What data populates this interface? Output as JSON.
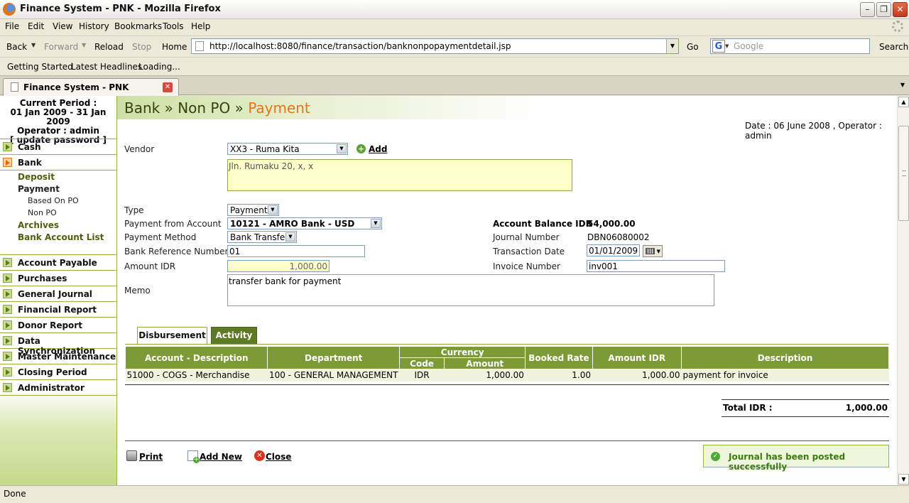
{
  "window": {
    "title": "Finance System - PNK - Mozilla Firefox"
  },
  "menu": [
    "File",
    "Edit",
    "View",
    "History",
    "Bookmarks",
    "Tools",
    "Help"
  ],
  "nav": {
    "back": "Back",
    "forward": "Forward",
    "reload": "Reload",
    "stop": "Stop",
    "home": "Home",
    "url": "http://localhost:8080/finance/transaction/banknonpopaymentdetail.jsp",
    "go": "Go",
    "search_placeholder": "Google",
    "search_button": "Search"
  },
  "bookmarks": [
    "Getting Started",
    "Latest Headlines",
    "Loading..."
  ],
  "tab": {
    "label": "Finance System - PNK"
  },
  "status": "Done",
  "sidebar": {
    "period_title": "Current Period :",
    "period_range": "01 Jan 2009 - 31 Jan 2009",
    "operator": "Operator : admin",
    "update_password": "[ update password ]",
    "items": [
      {
        "label": "Cash"
      },
      {
        "label": "Bank"
      },
      {
        "label": "Account Payable"
      },
      {
        "label": "Purchases"
      },
      {
        "label": "General Journal"
      },
      {
        "label": "Financial Report"
      },
      {
        "label": "Donor Report"
      },
      {
        "label": "Data Synchronization"
      },
      {
        "label": "Master Maintenance"
      },
      {
        "label": "Closing Period"
      },
      {
        "label": "Administrator"
      }
    ],
    "bank_sub": {
      "deposit": "Deposit",
      "payment": "Payment",
      "based_on_po": "Based On PO",
      "non_po": "Non PO",
      "archives": "Archives",
      "account_list": "Bank Account List"
    }
  },
  "page": {
    "breadcrumb_1": "Bank",
    "breadcrumb_2": "Non PO",
    "breadcrumb_current": "Payment",
    "sep": "»",
    "date_line": "Date : 06 June 2008 ,  Operator : admin"
  },
  "form": {
    "vendor_label": "Vendor",
    "vendor_value": "XX3 - Ruma Kita",
    "add_label": "Add",
    "address_value": "Jln. Rumaku 20, x, x",
    "type_label": "Type",
    "type_value": "Payment",
    "from_account_label": "Payment from Account",
    "from_account_value": "10121 - AMRO Bank - USD",
    "method_label": "Payment Method",
    "method_value": "Bank Transfer",
    "bank_ref_label": "Bank Reference Number",
    "bank_ref_value": "01",
    "amount_label": "Amount IDR",
    "amount_value": "1,000.00",
    "memo_label": "Memo",
    "memo_value": "transfer bank for payment",
    "balance_label": "Account Balance IDR",
    "balance_value": "54,000.00",
    "journal_label": "Journal Number",
    "journal_value": "DBN06080002",
    "trans_date_label": "Transaction Date",
    "trans_date_value": "01/01/2009",
    "invoice_label": "Invoice Number",
    "invoice_value": "inv001"
  },
  "detail_tabs": {
    "disbursement": "Disbursement",
    "activity": "Activity"
  },
  "grid": {
    "headers": {
      "account": "Account - Description",
      "department": "Department",
      "currency": "Currency",
      "code": "Code",
      "amount": "Amount",
      "booked_rate": "Booked Rate",
      "amount_idr": "Amount IDR",
      "description": "Description"
    },
    "rows": [
      {
        "account": "51000 -  COGS - Merchandise",
        "department": "100 - GENERAL MANAGEMENT",
        "code": "IDR",
        "amount": "1,000.00",
        "booked_rate": "1.00",
        "amount_idr": "1,000.00",
        "description": "payment for invoice"
      }
    ]
  },
  "total": {
    "label": "Total IDR :",
    "value": "1,000.00"
  },
  "actions": {
    "print": "Print",
    "add_new": "Add New",
    "close": "Close"
  },
  "message": "Journal has been posted successfully",
  "colors": {
    "accent_green": "#7c9a35",
    "current_orange": "#e8731a",
    "success_text": "#3e7a12"
  }
}
